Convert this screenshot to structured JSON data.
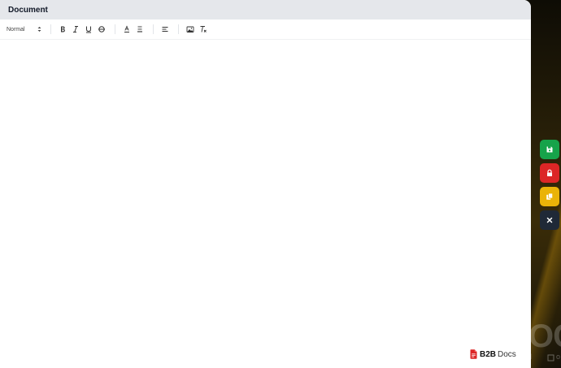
{
  "window": {
    "title": "Document"
  },
  "toolbar": {
    "heading_select": {
      "value": "Normal"
    },
    "buttons": [
      {
        "icon": "bold-icon"
      },
      {
        "icon": "italic-icon"
      },
      {
        "icon": "underline-icon"
      },
      {
        "icon": "strikethrough-icon"
      },
      {
        "icon": "text-color-icon"
      },
      {
        "icon": "highlight-icon"
      },
      {
        "icon": "align-icon"
      },
      {
        "icon": "image-icon"
      },
      {
        "icon": "clear-format-icon"
      }
    ]
  },
  "editor": {
    "content": ""
  },
  "brand": {
    "name": "B2B",
    "suffix": "Docs"
  },
  "side_actions": [
    {
      "icon": "save-icon",
      "color": "#16a34a"
    },
    {
      "icon": "lock-icon",
      "color": "#dc2626"
    },
    {
      "icon": "copy-icon",
      "color": "#eab308"
    },
    {
      "icon": "close-icon",
      "color": "#1f2937"
    }
  ],
  "background": {
    "big_text": "OC",
    "small_text": "l",
    "small_text_2": "o"
  }
}
